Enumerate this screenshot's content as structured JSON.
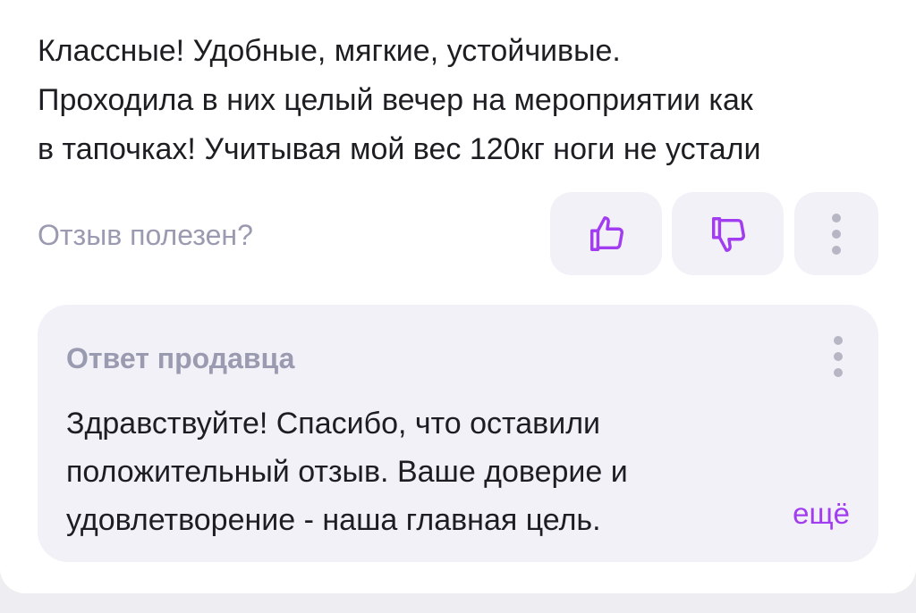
{
  "review": {
    "text": "Классные! Удобные, мягкие, устойчивые.\nПроходила в них целый вечер на мероприятии как\nв тапочках! Учитывая мой вес 120кг ноги не устали"
  },
  "helpful": {
    "label": "Отзыв полезен?",
    "like_icon": "thumbs-up-icon",
    "dislike_icon": "thumbs-down-icon",
    "more_icon": "more-vertical-icon"
  },
  "seller_answer": {
    "title": "Ответ продавца",
    "text": "Здравствуйте! Спасибо, что оставили\nположительный отзыв.  Ваше доверие и\nудовлетворение - наша главная цель.",
    "expand_label": "ещё",
    "more_icon": "more-vertical-icon"
  },
  "colors": {
    "accent": "#a23cf0",
    "muted_text": "#9a9ab0",
    "button_bg": "#f2f1f7",
    "text": "#1d1d22"
  }
}
